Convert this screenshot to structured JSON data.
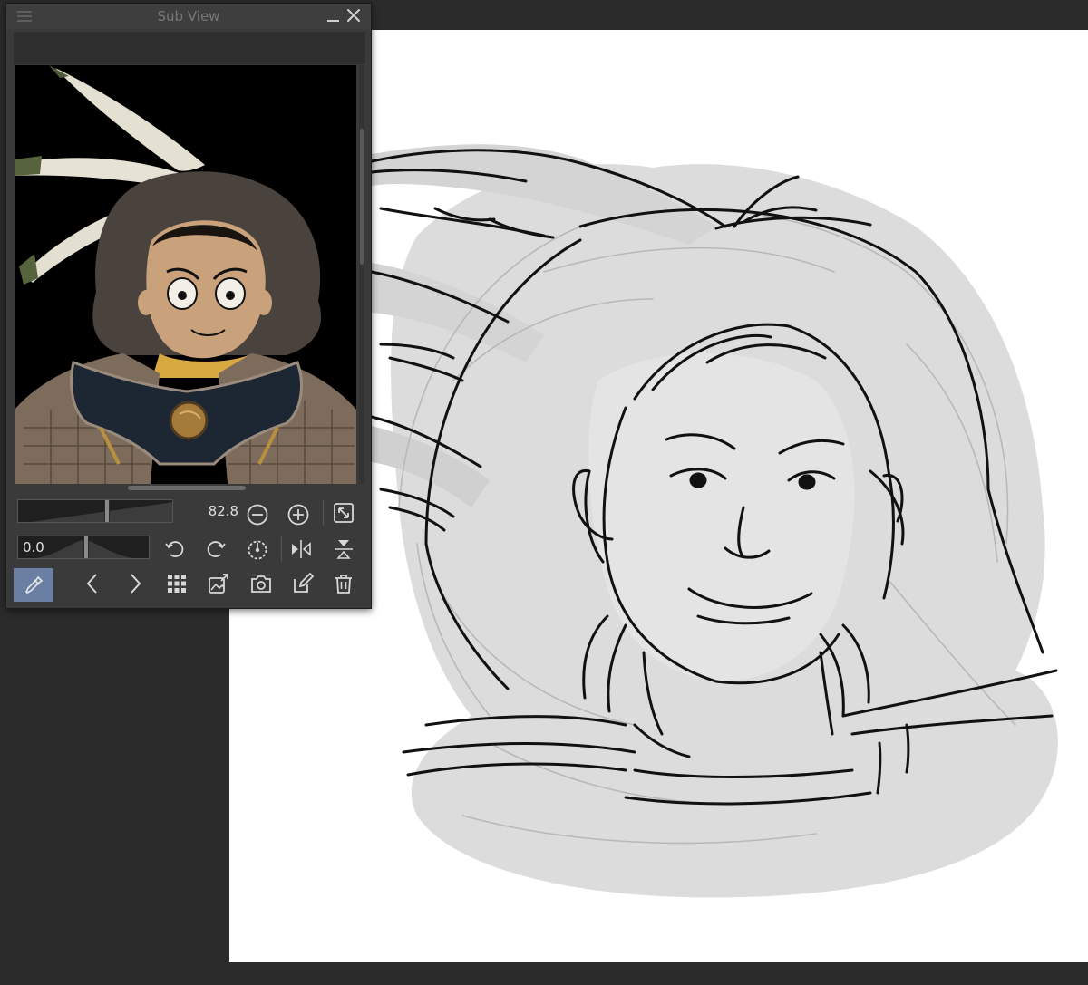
{
  "window": {
    "title": "Sub View"
  },
  "controls": {
    "zoom_value": "82.8",
    "zoom_level": 0.56,
    "rotation_value": "0.0",
    "rotation_level": 0.5
  },
  "icons": {
    "menu": "menu-icon",
    "minimize": "minimize-icon",
    "close": "close-icon",
    "zoom_out": "zoom-out-icon",
    "zoom_in": "zoom-in-icon",
    "fit": "fit-to-window-icon",
    "rotate_left": "rotate-left-icon",
    "rotate_right": "rotate-right-icon",
    "reset_rotation": "reset-rotation-icon",
    "flip_horizontal": "flip-horizontal-icon",
    "flip_vertical": "flip-vertical-icon",
    "eyedropper": "eyedropper-icon",
    "previous": "chevron-left-icon",
    "next": "chevron-right-icon",
    "gallery": "grid-icon",
    "import_image": "import-image-icon",
    "capture": "camera-icon",
    "edit": "edit-icon",
    "delete": "trash-icon"
  },
  "colors": {
    "panel_bg": "#3a3a3a",
    "canvas_bg": "#2b2b2b",
    "paper": "#ffffff",
    "active_tool": "#6b7fa3",
    "icon": "#d8d8d8"
  }
}
